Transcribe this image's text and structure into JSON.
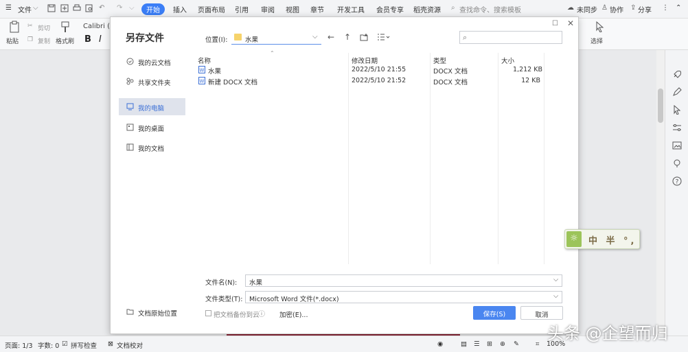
{
  "menubar": {
    "file": "文件",
    "tabs": [
      "开始",
      "插入",
      "页面布局",
      "引用",
      "审阅",
      "视图",
      "章节",
      "开发工具",
      "会员专享",
      "稻壳资源"
    ],
    "search_placeholder": "查找命令、搜索模板",
    "sync": "未同步",
    "collab": "协作",
    "share": "分享"
  },
  "ribbon": {
    "paste": "粘贴",
    "cut": "剪切",
    "copy": "复制",
    "format_painter": "格式刷",
    "font_name": "Calibri (",
    "bold": "B",
    "italic": "I",
    "select": "选择"
  },
  "dialog": {
    "title": "另存文件",
    "location_label": "位置(I):",
    "location_value": "水果",
    "nav": [
      {
        "label": "我的云文档"
      },
      {
        "label": "共享文件夹"
      },
      {
        "label": "我的电脑"
      },
      {
        "label": "我的桌面"
      },
      {
        "label": "我的文档"
      }
    ],
    "nav_bottom": "文档原始位置",
    "columns": [
      "名称",
      "修改日期",
      "类型",
      "大小"
    ],
    "files": [
      {
        "name": "水果",
        "date": "2022/5/10 21:55",
        "type": "DOCX 文档",
        "size": "1,212 KB"
      },
      {
        "name": "新建 DOCX 文档",
        "date": "2022/5/10 21:52",
        "type": "DOCX 文档",
        "size": "12 KB"
      }
    ],
    "filename_label": "文件名(N):",
    "filename_value": "水果",
    "filetype_label": "文件类型(T):",
    "filetype_value": "Microsoft Word 文件(*.docx)",
    "backup_label": "把文档备份到云",
    "encrypt_label": "加密(E)...",
    "save_label": "保存(S)",
    "cancel_label": "取消"
  },
  "statusbar": {
    "page": "页面: 1/3",
    "words": "字数: 0",
    "spell": "拼写检查",
    "proof": "文档校对",
    "zoom": "100%"
  },
  "ime": {
    "chars": "中 半 °,"
  },
  "watermark": "头条 @企望而归",
  "colors": {
    "accent": "#3b7ef6",
    "save_button": "#4a86f0"
  }
}
